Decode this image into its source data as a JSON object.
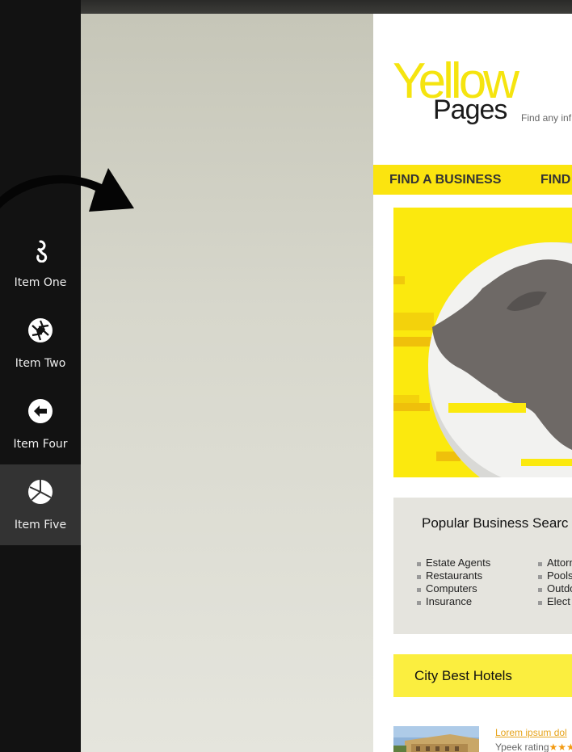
{
  "sidebar": {
    "items": [
      {
        "label": "Item One",
        "icon": "chain-link-icon"
      },
      {
        "label": "Item Two",
        "icon": "aperture-icon"
      },
      {
        "label": "Item Four",
        "icon": "arrow-left-circle-icon"
      },
      {
        "label": "Item Five",
        "icon": "pie-chart-icon"
      }
    ],
    "active_index": 3,
    "active_color": "#333333"
  },
  "site": {
    "logo": {
      "word1": "Yellow",
      "word2": "Pages",
      "tagline": "Find any inf"
    },
    "nav": [
      "FIND A BUSINESS",
      "FIND"
    ],
    "popular": {
      "title": "Popular Business Searc",
      "col1": [
        "Estate Agents",
        "Restaurants",
        "Computers",
        "Insurance"
      ],
      "col2": [
        "Attorn",
        "Pools",
        "Outdo",
        "Elect"
      ]
    },
    "hotels": {
      "title": "City Best Hotels",
      "first": {
        "link": "Lorem ipsum dol",
        "rating_label": "Ypeek rating",
        "stars": "★★★"
      }
    },
    "colors": {
      "brand_yellow": "#fbe40f",
      "link_orange": "#e7a41c"
    }
  }
}
